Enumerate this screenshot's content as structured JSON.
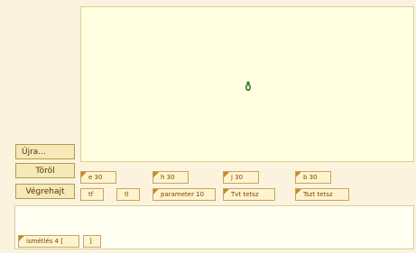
{
  "buttons": {
    "restart": "Újra...",
    "clear": "Töröl",
    "execute": "Végrehajt"
  },
  "commands": {
    "row1": [
      "e 30",
      "h 30",
      "j 30",
      "b 30"
    ],
    "row2": [
      "tf",
      "tl",
      "parameter 10",
      "Tvt tetsz",
      "Tszt tetsz"
    ]
  },
  "program": {
    "repeat_label": "ismétlés 4 [",
    "repeat_close": "]"
  },
  "turtle": {
    "icon": "turtle-icon",
    "color": "#2f7a2a"
  }
}
